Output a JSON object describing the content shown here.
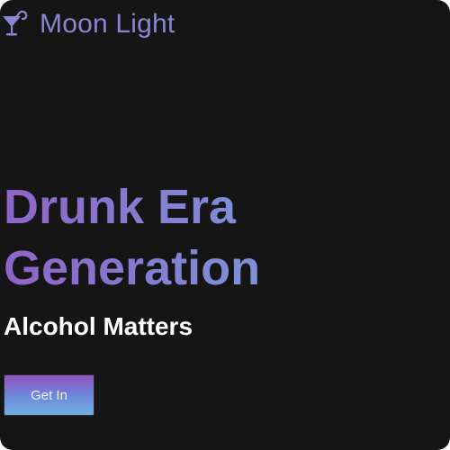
{
  "header": {
    "brand_name": "Moon Light",
    "logo_icon": "cocktail-glass-icon",
    "brand_color": "#8a84d2"
  },
  "hero": {
    "title_line1": "Drunk Era",
    "title_line2": "Generation",
    "subtitle": "Alcohol Matters",
    "cta_label": "Get In"
  },
  "colors": {
    "background": "#151515",
    "gradient_purple": "#8f63c7",
    "gradient_blue": "#6fb6ea",
    "subtitle_text": "#ffffff"
  }
}
